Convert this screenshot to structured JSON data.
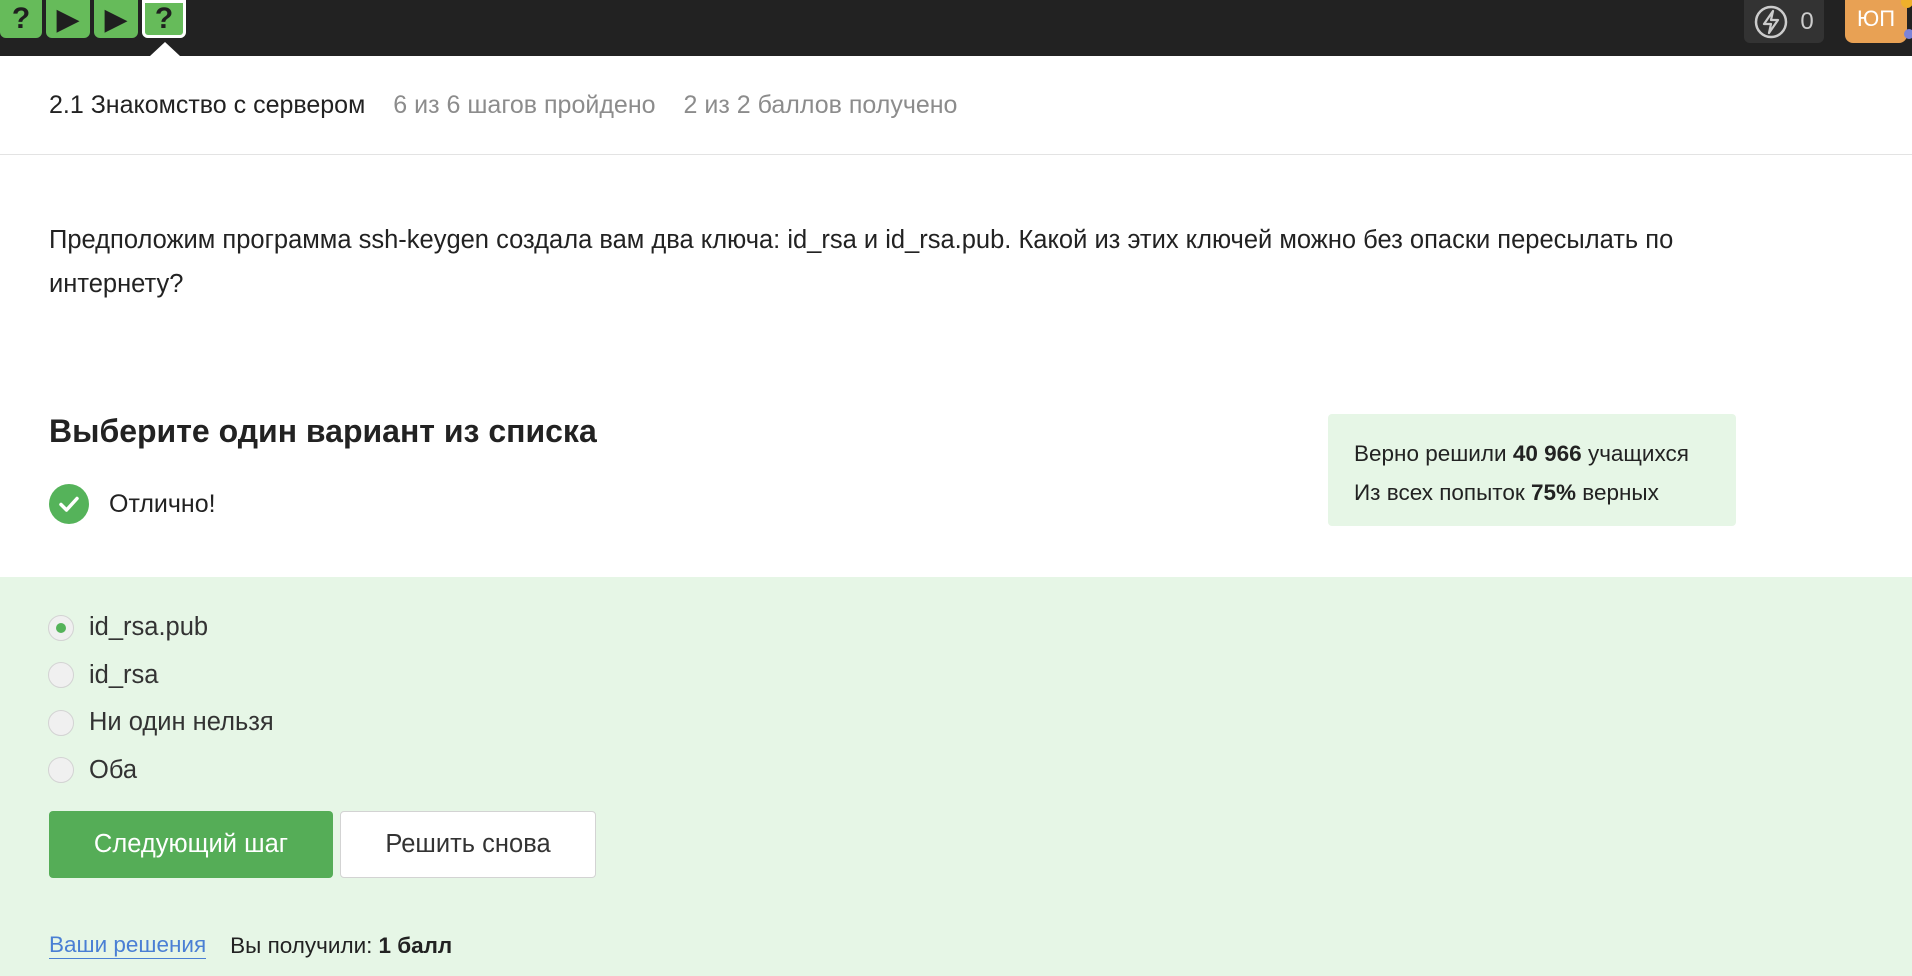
{
  "topbar": {
    "steps": [
      {
        "icon": "question-icon",
        "glyph": "?"
      },
      {
        "icon": "play-icon",
        "glyph": "▶"
      },
      {
        "icon": "play-icon",
        "glyph": "▶"
      },
      {
        "icon": "question-icon",
        "glyph": "?"
      }
    ],
    "energy_count": "0",
    "avatar_initials": "ЮП"
  },
  "lesson": {
    "title": "2.1 Знакомство с сервером",
    "progress": "6 из 6 шагов пройдено",
    "points": "2 из 2 баллов  получено"
  },
  "question": {
    "text": "Предположим программа ssh-keygen создала вам два ключа: id_rsa и id_rsa.pub. Какой из этих ключей можно без опаски пересылать по интернету?"
  },
  "quiz": {
    "choose_title": "Выберите один вариант из списка",
    "result_text": "Отлично!",
    "options": [
      "id_rsa.pub",
      "id_rsa",
      "Ни один нельзя",
      "Оба"
    ],
    "selected_index": 0,
    "next_button": "Следующий шаг",
    "retry_button": "Решить снова"
  },
  "stats": {
    "line1_prefix": "Верно решили",
    "line1_value": "40 966",
    "line1_suffix": "учащихся",
    "line2_prefix": "Из всех попыток",
    "line2_value": "75%",
    "line2_suffix": "верных"
  },
  "footer": {
    "solutions_link": "Ваши решения",
    "score_label": "Вы получили:",
    "score_value": "1 балл"
  },
  "colors": {
    "accent_green": "#55ad57",
    "answer_bg": "#e6f6e6",
    "link_blue": "#4a7fd4",
    "avatar_orange": "#e8a154"
  }
}
